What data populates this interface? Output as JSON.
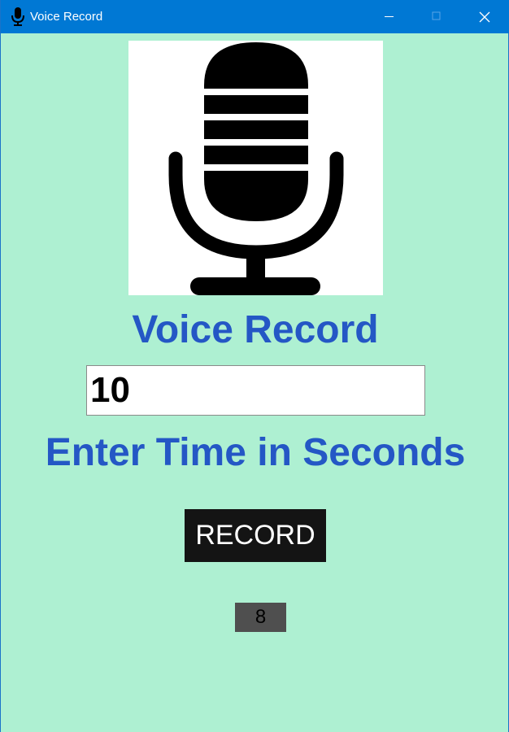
{
  "window": {
    "title": "Voice Record",
    "title_icon": "microphone-icon",
    "controls": {
      "minimize_icon": "minimize-icon",
      "maximize_icon": "maximize-icon",
      "close_icon": "close-icon"
    },
    "titlebar_color": "#0078d4"
  },
  "main": {
    "image_icon": "microphone-icon",
    "heading": "Voice Record",
    "time_input_value": "10",
    "time_label": "Enter Time in Seconds",
    "record_label": "RECORD",
    "counter_value": "8"
  },
  "colors": {
    "background": "#aef0d2",
    "heading": "#2457c5",
    "record_button": "#141414",
    "counter_bg": "#4f4f4f"
  }
}
